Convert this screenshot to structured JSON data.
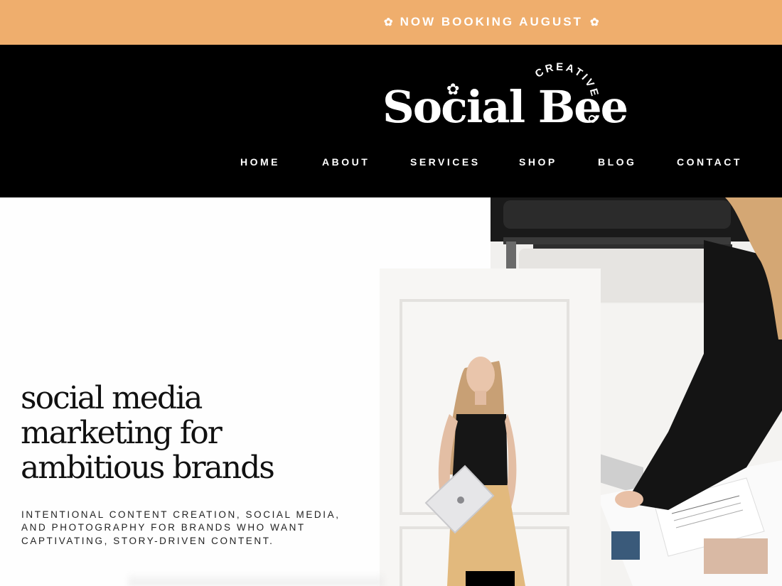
{
  "announcement": {
    "text": "NOW BOOKING AUGUST",
    "icon_left": "flower-icon",
    "icon_right": "flower-icon"
  },
  "header": {
    "logo_text": "Social Bee",
    "logo_arc_text": "CREATIVE CO",
    "nav": [
      {
        "label": "HOME"
      },
      {
        "label": "ABOUT"
      },
      {
        "label": "SERVICES"
      },
      {
        "label": "SHOP"
      },
      {
        "label": "BLOG"
      },
      {
        "label": "CONTACT"
      }
    ]
  },
  "hero": {
    "title": "social media marketing for ambitious brands",
    "subtitle": "INTENTIONAL CONTENT CREATION, SOCIAL MEDIA, AND PHOTOGRAPHY FOR BRANDS WHO WANT CAPTIVATING, STORY-DRIVEN CONTENT."
  },
  "colors": {
    "announcement_bg": "#efae6d",
    "header_bg": "#000000",
    "text_dark": "#111111",
    "white": "#ffffff"
  }
}
